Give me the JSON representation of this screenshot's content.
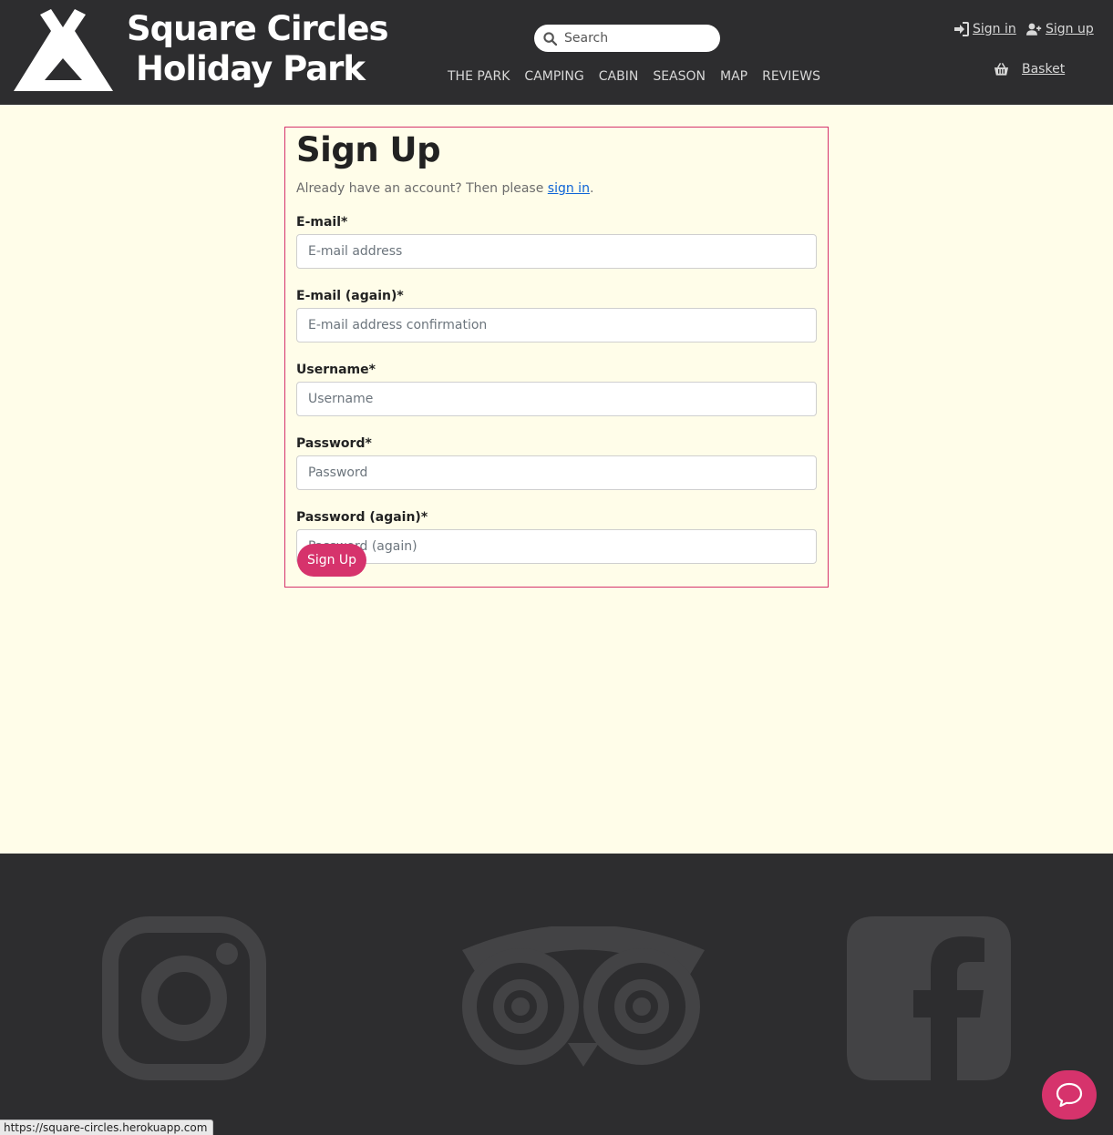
{
  "header": {
    "logo_line1": "Square Circles",
    "logo_line2": "Holiday Park",
    "search_placeholder": "Search",
    "nav": [
      "THE PARK",
      "CAMPING",
      "CABIN",
      "SEASON",
      "MAP",
      "REVIEWS"
    ],
    "sign_in": "Sign in",
    "sign_up": "Sign up",
    "basket": "Basket"
  },
  "form": {
    "title": "Sign Up",
    "intro_prefix": "Already have an account? Then please ",
    "intro_link": "sign in",
    "intro_suffix": ".",
    "fields": [
      {
        "label": "E-mail*",
        "placeholder": "E-mail address"
      },
      {
        "label": "E-mail (again)*",
        "placeholder": "E-mail address confirmation"
      },
      {
        "label": "Username*",
        "placeholder": "Username"
      },
      {
        "label": "Password*",
        "placeholder": "Password"
      },
      {
        "label": "Password (again)*",
        "placeholder": "Password (again)"
      }
    ],
    "submit": "Sign Up"
  },
  "footer": {
    "icons": [
      "instagram-icon",
      "tripadvisor-icon",
      "facebook-icon"
    ]
  },
  "status_url": "https://square-circles.herokuapp.com",
  "colors": {
    "header_bg": "#2d2d2f",
    "page_bg": "#fffde9",
    "accent": "#d6336c",
    "footer_icon": "#434345"
  }
}
